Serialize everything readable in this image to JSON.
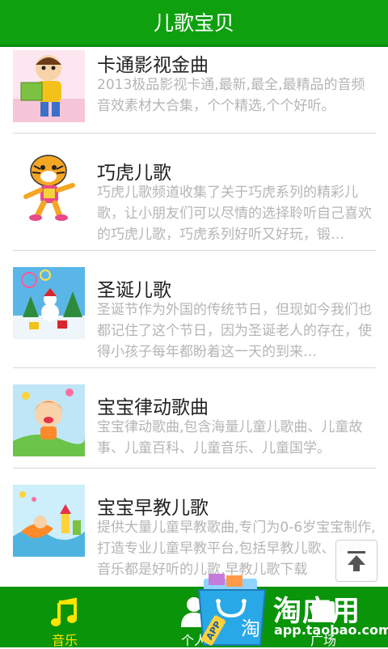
{
  "header": {
    "title": "儿歌宝贝"
  },
  "items": [
    {
      "title": "卡通影视金曲",
      "desc": "2013极品影视卡通,最新,最全,最精品的音频音效素材大合集，个个精选,个个好听。"
    },
    {
      "title": "巧虎儿歌",
      "desc": "巧虎儿歌频道收集了关于巧虎系列的精彩儿歌，让小朋友们可以尽情的选择聆听自己喜欢的巧虎儿歌，巧虎系列好听又好玩，锻…"
    },
    {
      "title": "圣诞儿歌",
      "desc": "圣诞节作为外国的传统节日，但现如今我们也都记住了这个节日，因为圣诞老人的存在，使得小孩子每年都盼着这一天的到来…"
    },
    {
      "title": "宝宝律动歌曲",
      "desc": "宝宝律动歌曲,包含海量儿童儿歌曲、儿童故事、儿童百科、儿童音乐、儿童国学。"
    },
    {
      "title": "宝宝早教儿歌",
      "desc": "提供大量儿童早教歌曲,专门为0-6岁宝宝制作,打造专业儿童早教平台,包括早教儿歌、早教音乐都是好听的儿歌,早教儿歌下载"
    }
  ],
  "tabs": [
    {
      "label": "音乐",
      "icon": "music-note-icon",
      "active": true
    },
    {
      "label": "个人",
      "icon": "person-icon",
      "active": false
    },
    {
      "label": "广场",
      "icon": "plaza-icon",
      "active": false
    }
  ],
  "watermark": {
    "brand": "淘应用",
    "url": "app.taobao.com",
    "badge": "APP",
    "bag_char": "淘"
  },
  "colors": {
    "header_green": "#0fa00f",
    "tab_green": "#0a940a",
    "active_tab": "#ffe400",
    "desc_gray": "#b5b5b5"
  }
}
